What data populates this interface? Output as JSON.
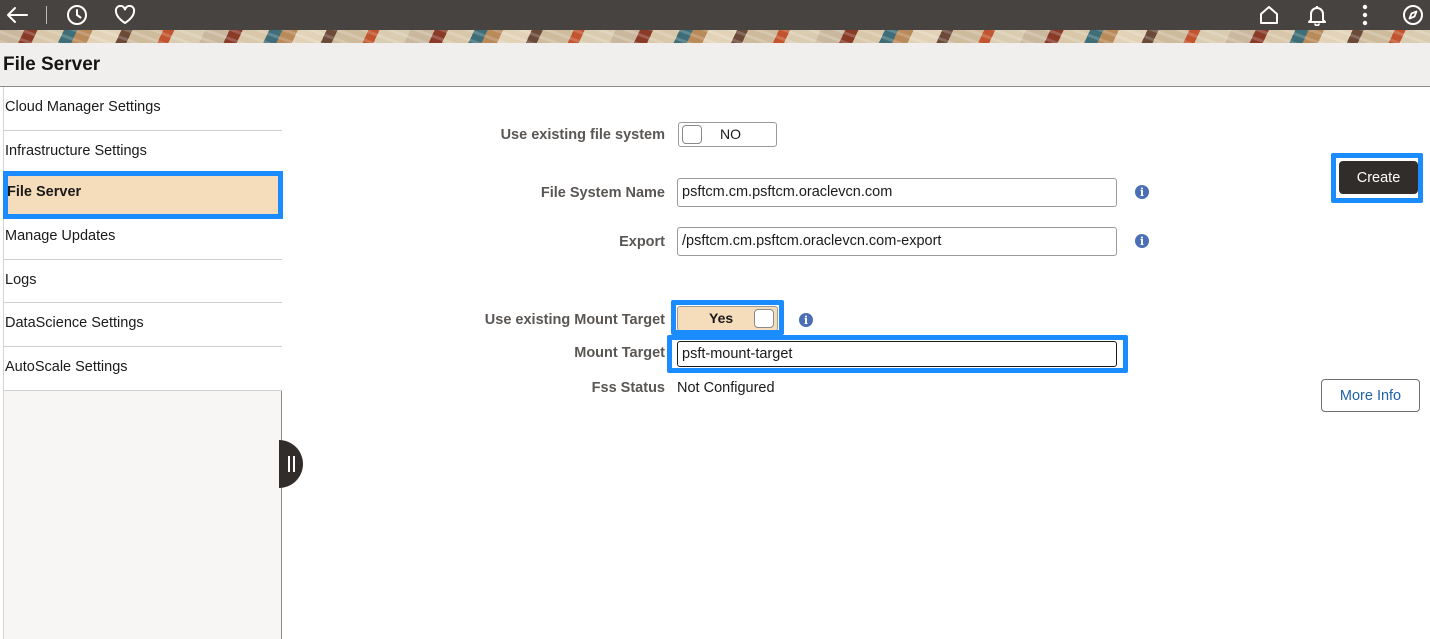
{
  "header": {
    "icons": {
      "back": "arrow-left-icon",
      "recent": "clock-icon",
      "favorites": "heart-icon",
      "home": "home-icon",
      "notifications": "bell-icon",
      "actions": "more-vertical-icon",
      "navigator": "compass-icon"
    }
  },
  "page": {
    "title": "File Server"
  },
  "sidebar": {
    "items": [
      {
        "label": "Cloud Manager Settings"
      },
      {
        "label": "Infrastructure Settings"
      },
      {
        "label": "File Server",
        "active": true
      },
      {
        "label": "Manage Updates"
      },
      {
        "label": "Logs"
      },
      {
        "label": "DataScience Settings"
      },
      {
        "label": "AutoScale Settings"
      }
    ]
  },
  "form": {
    "use_existing_fs": {
      "label": "Use existing file system",
      "value": "NO"
    },
    "fs_name": {
      "label": "File System Name",
      "value": "psftcm.cm.psftcm.oraclevcn.com"
    },
    "export": {
      "label": "Export",
      "value": "/psftcm.cm.psftcm.oraclevcn.com-export"
    },
    "use_existing_mt": {
      "label": "Use existing Mount Target",
      "value": "Yes"
    },
    "mount_target": {
      "label": "Mount Target",
      "value": "psft-mount-target"
    },
    "fss_status": {
      "label": "Fss Status",
      "value": "Not Configured"
    }
  },
  "buttons": {
    "create": "Create",
    "more_info": "More Info"
  },
  "colors": {
    "accent_highlight": "#1a8cff",
    "active_item_bg": "#f5dcbb",
    "topbar": "#474340",
    "primary_button": "#312d2a"
  }
}
